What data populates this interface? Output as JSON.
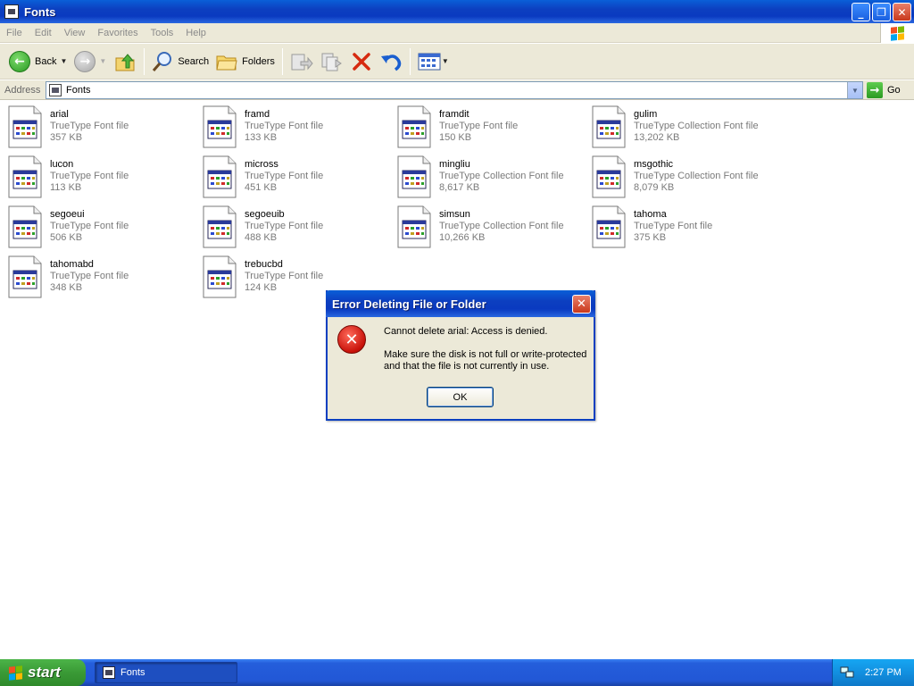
{
  "window": {
    "title": "Fonts"
  },
  "menu": [
    "File",
    "Edit",
    "View",
    "Favorites",
    "Tools",
    "Help"
  ],
  "toolbar": {
    "back_label": "Back",
    "search_label": "Search",
    "folders_label": "Folders"
  },
  "address": {
    "label": "Address",
    "value": "Fonts",
    "go_label": "Go"
  },
  "files": [
    {
      "name": "arial",
      "type": "TrueType Font file",
      "size": "357 KB"
    },
    {
      "name": "framd",
      "type": "TrueType Font file",
      "size": "133 KB"
    },
    {
      "name": "framdit",
      "type": "TrueType Font file",
      "size": "150 KB"
    },
    {
      "name": "gulim",
      "type": "TrueType Collection Font file",
      "size": "13,202 KB"
    },
    {
      "name": "lucon",
      "type": "TrueType Font file",
      "size": "113 KB"
    },
    {
      "name": "micross",
      "type": "TrueType Font file",
      "size": "451 KB"
    },
    {
      "name": "mingliu",
      "type": "TrueType Collection Font file",
      "size": "8,617 KB"
    },
    {
      "name": "msgothic",
      "type": "TrueType Collection Font file",
      "size": "8,079 KB"
    },
    {
      "name": "segoeui",
      "type": "TrueType Font file",
      "size": "506 KB"
    },
    {
      "name": "segoeuib",
      "type": "TrueType Font file",
      "size": "488 KB"
    },
    {
      "name": "simsun",
      "type": "TrueType Collection Font file",
      "size": "10,266 KB"
    },
    {
      "name": "tahoma",
      "type": "TrueType Font file",
      "size": "375 KB"
    },
    {
      "name": "tahomabd",
      "type": "TrueType Font file",
      "size": "348 KB"
    },
    {
      "name": "trebucbd",
      "type": "TrueType Font file",
      "size": "124 KB"
    }
  ],
  "dialog": {
    "title": "Error Deleting File or Folder",
    "message": "Cannot delete arial: Access is denied.",
    "detail": "Make sure the disk is not full or write-protected and that the file is not currently in use.",
    "ok_label": "OK"
  },
  "taskbar": {
    "start_label": "start",
    "task_label": "Fonts",
    "clock": "2:27 PM"
  },
  "colors": {
    "titlebar": "#0a3ac0",
    "chrome": "#ece9d8",
    "taskbar": "#245edb",
    "start": "#3a9a36",
    "error": "#c8120a"
  },
  "icons": [
    "fonts-folder-icon",
    "back-icon",
    "forward-icon",
    "up-folder-icon",
    "search-icon",
    "folders-icon",
    "move-to-icon",
    "copy-to-icon",
    "delete-icon",
    "undo-icon",
    "views-icon",
    "go-icon",
    "error-icon",
    "windows-logo-icon",
    "network-icon"
  ]
}
